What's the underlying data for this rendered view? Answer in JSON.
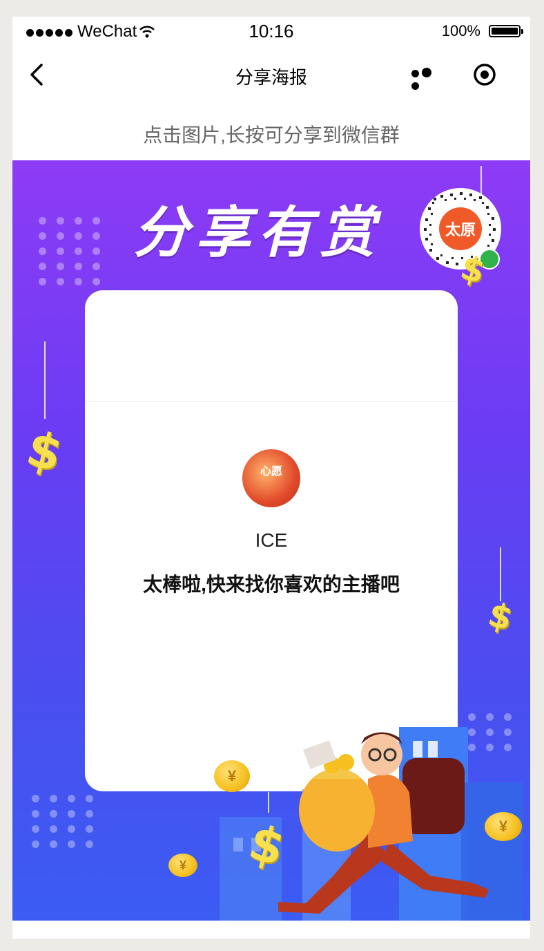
{
  "status_bar": {
    "carrier": "WeChat",
    "time": "10:16",
    "battery": "100%"
  },
  "nav": {
    "title": "分享海报"
  },
  "hint": "点击图片,长按可分享到微信群",
  "poster": {
    "headline": "分享有赏",
    "qr_center_text": "太原",
    "card": {
      "avatar_text": "心愿",
      "username": "ICE",
      "slogan": "太棒啦,快来找你喜欢的主播吧"
    },
    "currency_symbol": "$",
    "coin_symbol": "¥"
  },
  "colors": {
    "poster_top": "#8e3bf5",
    "poster_bottom": "#3b5cf2",
    "accent_gold": "#f7e04d",
    "hint_text": "#666666"
  },
  "icons": [
    "back-chevron-icon",
    "more-icon",
    "close-target-icon",
    "wifi-icon",
    "battery-icon"
  ]
}
